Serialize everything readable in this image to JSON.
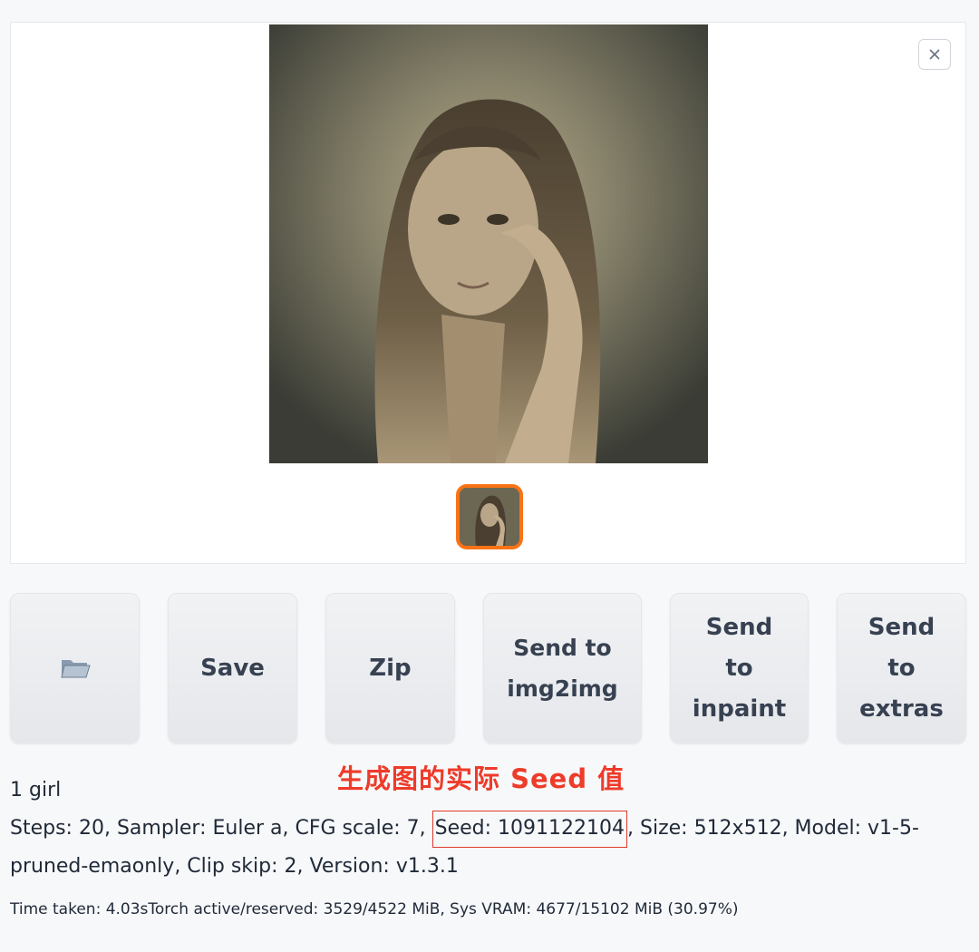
{
  "gallery": {
    "main_image_alt": "",
    "close_label": "×"
  },
  "toolbar": {
    "folder_icon": "open-folder-icon",
    "save_label": "Save",
    "zip_label": "Zip",
    "send_img2img_label": "Send to\nimg2img",
    "send_inpaint_label": "Send\nto\ninpaint",
    "send_extras_label": "Send\nto\nextras"
  },
  "annotation": {
    "text": "生成图的实际 Seed 值",
    "color": "#ee3b2a"
  },
  "generation_info": {
    "prompt": "1 girl",
    "params_before_seed": "Steps: 20, Sampler: Euler a, CFG scale: 7, ",
    "seed_text": "Seed: 1091122104",
    "params_after_seed": ", Size: 512x512, Model: v1-5-pruned-emaonly, Clip skip: 2, Version: v1.3.1"
  },
  "timing": {
    "text": "Time taken: 4.03sTorch active/reserved: 3529/4522 MiB, Sys VRAM: 4677/15102 MiB (30.97%)"
  },
  "colors": {
    "accent_orange": "#f97316",
    "annotation_red": "#e03a2b"
  }
}
